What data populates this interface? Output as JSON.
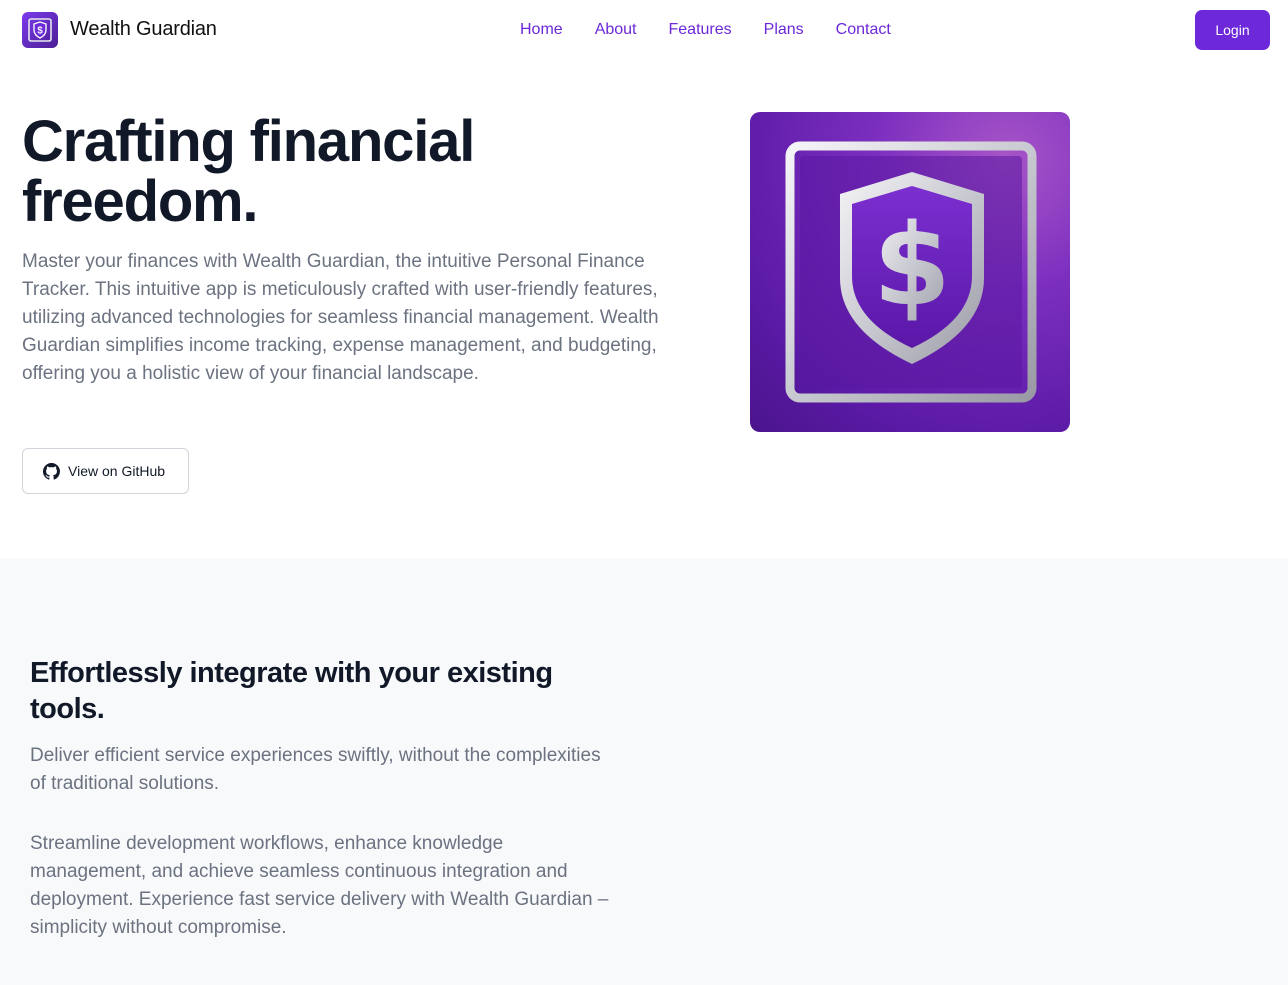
{
  "header": {
    "brand": "Wealth Guardian",
    "logo_icon": "shield-dollar-icon",
    "nav": [
      {
        "label": "Home"
      },
      {
        "label": "About"
      },
      {
        "label": "Features"
      },
      {
        "label": "Plans"
      },
      {
        "label": "Contact"
      }
    ],
    "login_label": "Login"
  },
  "hero": {
    "title": "Crafting financial freedom.",
    "description": "Master your finances with Wealth Guardian, the intuitive Personal Finance Tracker. This intuitive app is meticulously crafted with user-friendly features, utilizing advanced technologies for seamless financial management. Wealth Guardian simplifies income tracking, expense management, and budgeting, offering you a holistic view of your financial landscape.",
    "github_label": "View on GitHub",
    "github_icon": "github-icon",
    "image_icon": "shield-dollar-icon"
  },
  "integrate": {
    "title": "Effortlessly integrate with your existing tools.",
    "paragraph1": "Deliver efficient service experiences swiftly, without the complexities of traditional solutions.",
    "paragraph2": "Streamline development workflows, enhance knowledge management, and achieve seamless continuous integration and deployment. Experience fast service delivery with Wealth Guardian – simplicity without compromise."
  },
  "colors": {
    "accent": "#6d28d9",
    "heading": "#111827",
    "body_text": "#6b7280",
    "section_bg": "#f8f9fb"
  }
}
